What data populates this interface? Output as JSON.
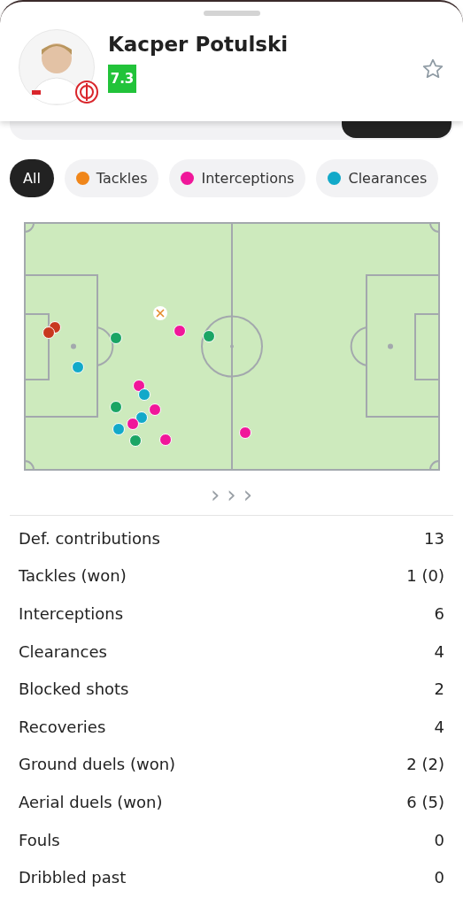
{
  "player": {
    "name": "Kacper Potulski",
    "rating": "7.3",
    "favorite": false
  },
  "tabs": [
    {
      "selected": false
    },
    {
      "selected": false
    },
    {
      "selected": false
    },
    {
      "selected": true
    }
  ],
  "filters": [
    {
      "label": "All",
      "selected": true
    },
    {
      "label": "Tackles",
      "selected": false,
      "color": "#f0861a"
    },
    {
      "label": "Interceptions",
      "selected": false,
      "color": "#f0179a"
    },
    {
      "label": "Clearances",
      "selected": false,
      "color": "#12a9c9"
    }
  ],
  "pitch": {
    "next": [
      "›",
      "›",
      "›"
    ]
  },
  "stats": [
    {
      "label": "Def. contributions",
      "value": "13"
    },
    {
      "label": "Tackles (won)",
      "value": "1 (0)"
    },
    {
      "label": "Interceptions",
      "value": "6"
    },
    {
      "label": "Clearances",
      "value": "4"
    },
    {
      "label": "Blocked shots",
      "value": "2"
    },
    {
      "label": "Recoveries",
      "value": "4"
    },
    {
      "label": "Ground duels (won)",
      "value": "2 (2)"
    },
    {
      "label": "Aerial duels (won)",
      "value": "6 (5)"
    },
    {
      "label": "Fouls",
      "value": "0"
    },
    {
      "label": "Dribbled past",
      "value": "0"
    }
  ]
}
